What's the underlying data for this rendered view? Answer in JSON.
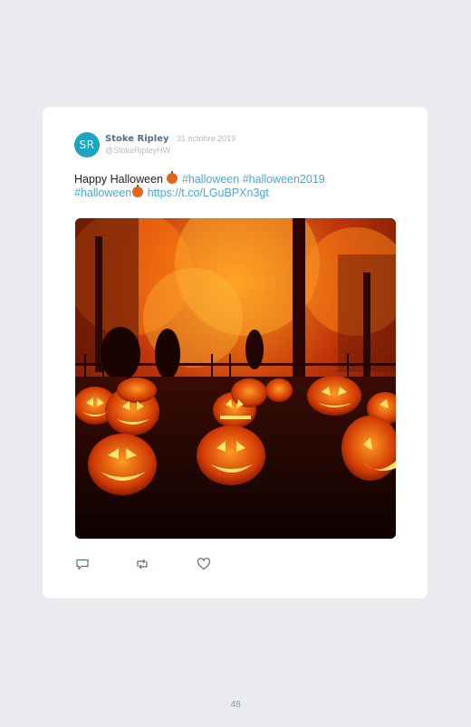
{
  "tweet": {
    "avatar_initials": "SR",
    "author_name": "Stoke Ripley",
    "separator": "·",
    "date": "31 octobre 2019",
    "handle": "@StokeRipleyHW",
    "text_plain": "Happy Halloween",
    "hashtag_1": "#halloween",
    "hashtag_2": "#halloween2019",
    "hashtag_3": "#halloween",
    "link": "https://t.co/LGuBPXn3gt",
    "emoji_name": "jack-o-lantern-emoji",
    "image_description_icon": "halloween-pumpkins-photo"
  },
  "actions": {
    "reply_icon": "reply-icon",
    "retweet_icon": "retweet-icon",
    "like_icon": "like-icon"
  },
  "footer": {
    "page_number": "48"
  },
  "colors": {
    "accent": "#4aa8d8",
    "avatar_bg": "#1fa3c4",
    "name": "#4f6f88",
    "muted": "#b3bcc6"
  }
}
